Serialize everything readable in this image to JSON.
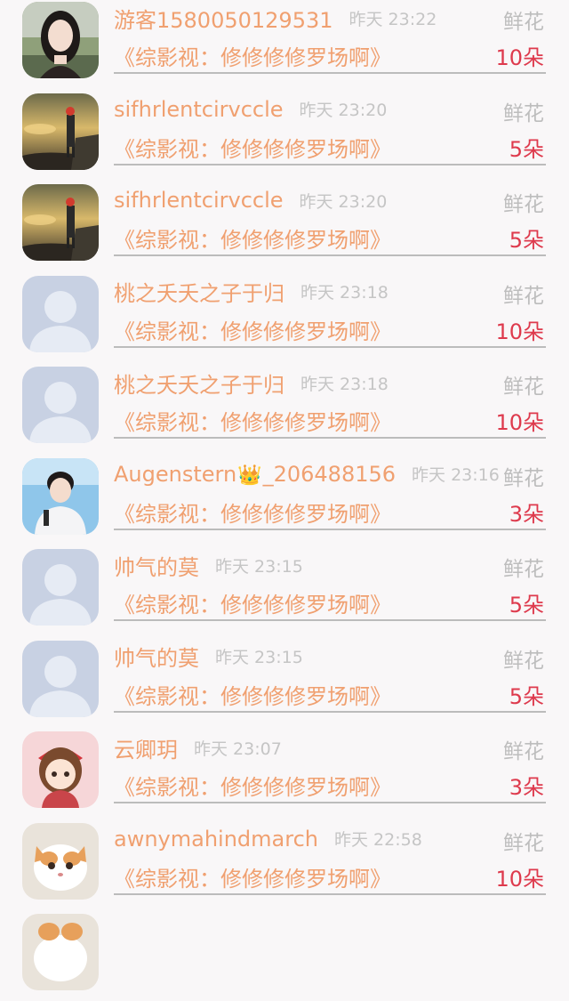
{
  "items": [
    {
      "name": "游客1580050129531",
      "time": "昨天 23:22",
      "gift": "鲜花",
      "book": "《综影视：修修修修罗场啊》",
      "count": "10朵",
      "avatar": "woman-photo"
    },
    {
      "name": "sifhrlentcirvccle",
      "time": "昨天 23:20",
      "gift": "鲜花",
      "book": "《综影视：修修修修罗场啊》",
      "count": "5朵",
      "avatar": "landscape-photo"
    },
    {
      "name": "sifhrlentcirvccle",
      "time": "昨天 23:20",
      "gift": "鲜花",
      "book": "《综影视：修修修修罗场啊》",
      "count": "5朵",
      "avatar": "landscape-photo"
    },
    {
      "name": "桃之夭夭之子于归",
      "time": "昨天 23:18",
      "gift": "鲜花",
      "book": "《综影视：修修修修罗场啊》",
      "count": "10朵",
      "avatar": "default-avatar"
    },
    {
      "name": "桃之夭夭之子于归",
      "time": "昨天 23:18",
      "gift": "鲜花",
      "book": "《综影视：修修修修罗场啊》",
      "count": "10朵",
      "avatar": "default-avatar"
    },
    {
      "name": "Augenstern",
      "name_suffix": "_206488156",
      "time": "昨天 23:16",
      "gift": "鲜花",
      "book": "《综影视：修修修修罗场啊》",
      "count": "3朵",
      "avatar": "young-man-photo"
    },
    {
      "name": "帅气的莫",
      "time": "昨天 23:15",
      "gift": "鲜花",
      "book": "《综影视：修修修修罗场啊》",
      "count": "5朵",
      "avatar": "default-avatar"
    },
    {
      "name": "帅气的莫",
      "time": "昨天 23:15",
      "gift": "鲜花",
      "book": "《综影视：修修修修罗场啊》",
      "count": "5朵",
      "avatar": "default-avatar"
    },
    {
      "name": "云卿玥",
      "time": "昨天 23:07",
      "gift": "鲜花",
      "book": "《综影视：修修修修罗场啊》",
      "count": "3朵",
      "avatar": "cartoon-girl"
    },
    {
      "name": "awnymahindmarch",
      "time": "昨天 22:58",
      "gift": "鲜花",
      "book": "《综影视：修修修修罗场啊》",
      "count": "10朵",
      "avatar": "cat-photo"
    }
  ],
  "colors": {
    "name": "#f0a070",
    "time": "#c5c5c5",
    "count": "#de3a4d",
    "background": "#f9f7f8"
  }
}
